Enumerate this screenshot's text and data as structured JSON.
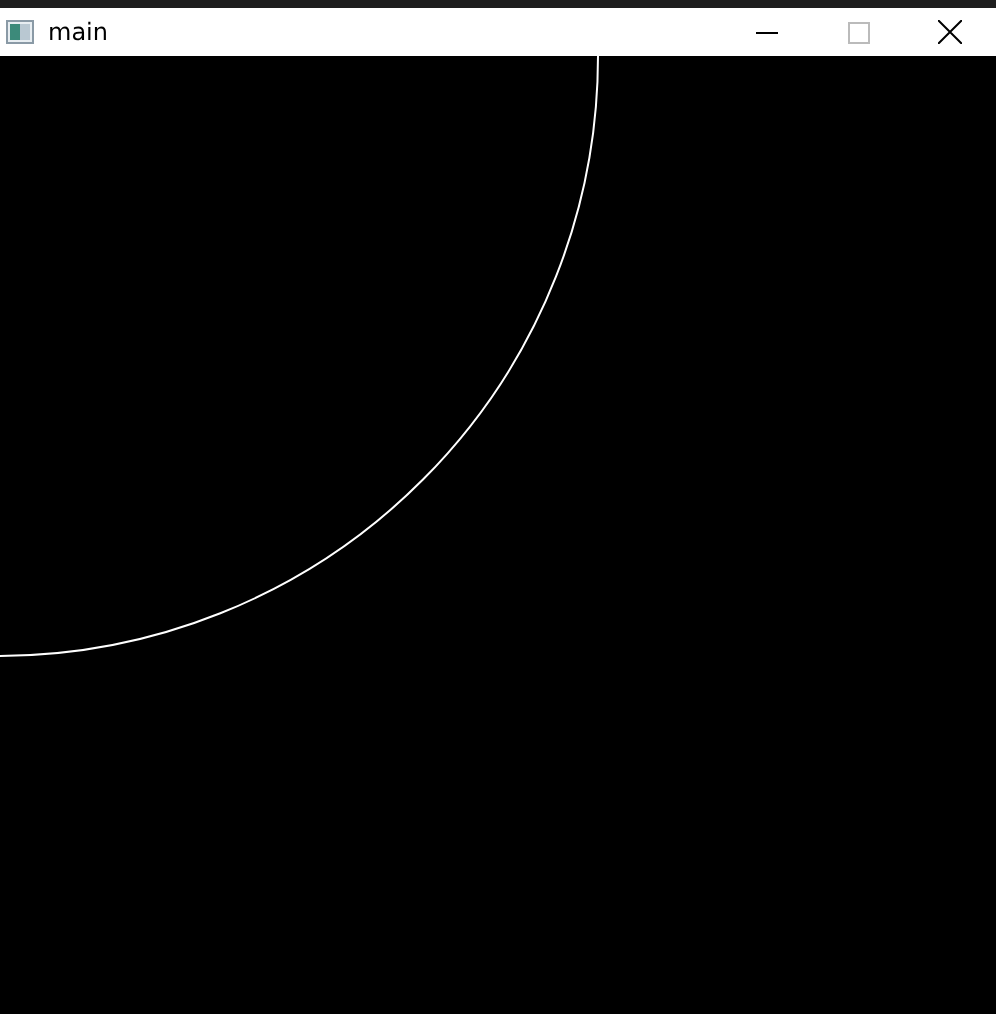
{
  "window": {
    "title": "main"
  },
  "canvas": {
    "shapes": [
      {
        "kind": "arc"
      }
    ]
  }
}
